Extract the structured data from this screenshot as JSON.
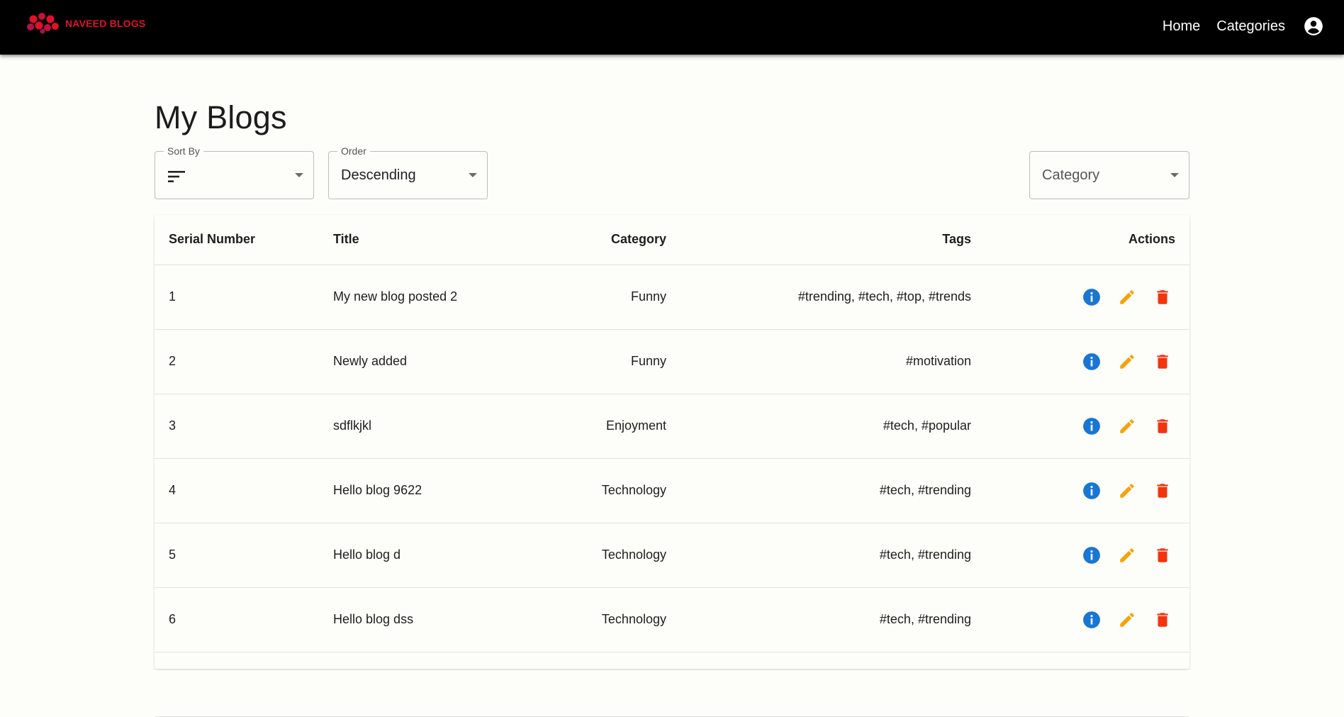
{
  "header": {
    "brand": "NAVEED BLOGS",
    "nav": [
      {
        "label": "Home"
      },
      {
        "label": "Categories"
      }
    ],
    "account_icon": "account-circle-icon"
  },
  "page": {
    "title": "My Blogs"
  },
  "filters": {
    "sort_by": {
      "legend": "Sort By",
      "value": "",
      "icon": "sort-icon"
    },
    "order": {
      "legend": "Order",
      "value": "Descending"
    },
    "category": {
      "placeholder": "Category"
    }
  },
  "table": {
    "columns": [
      "Serial Number",
      "Title",
      "Category",
      "Tags",
      "Actions"
    ],
    "rows": [
      {
        "serial": "1",
        "title": "My new blog posted 2",
        "category": "Funny",
        "tags": "#trending, #tech, #top, #trends"
      },
      {
        "serial": "2",
        "title": "Newly added",
        "category": "Funny",
        "tags": "#motivation"
      },
      {
        "serial": "3",
        "title": "sdflkjkl",
        "category": "Enjoyment",
        "tags": "#tech, #popular"
      },
      {
        "serial": "4",
        "title": "Hello blog 9622",
        "category": "Technology",
        "tags": "#tech, #trending"
      },
      {
        "serial": "5",
        "title": "Hello blog d",
        "category": "Technology",
        "tags": "#tech, #trending"
      },
      {
        "serial": "6",
        "title": "Hello blog dss",
        "category": "Technology",
        "tags": "#tech, #trending"
      },
      {
        "serial": "",
        "title": "",
        "category": "",
        "tags": ""
      }
    ],
    "action_icons": [
      "info-icon",
      "edit-icon",
      "delete-icon"
    ]
  },
  "colors": {
    "appbar": "#000000",
    "brand": "#e0112b",
    "info": "#1976d2",
    "edit": "#f5a30a",
    "delete": "#f4330f"
  }
}
